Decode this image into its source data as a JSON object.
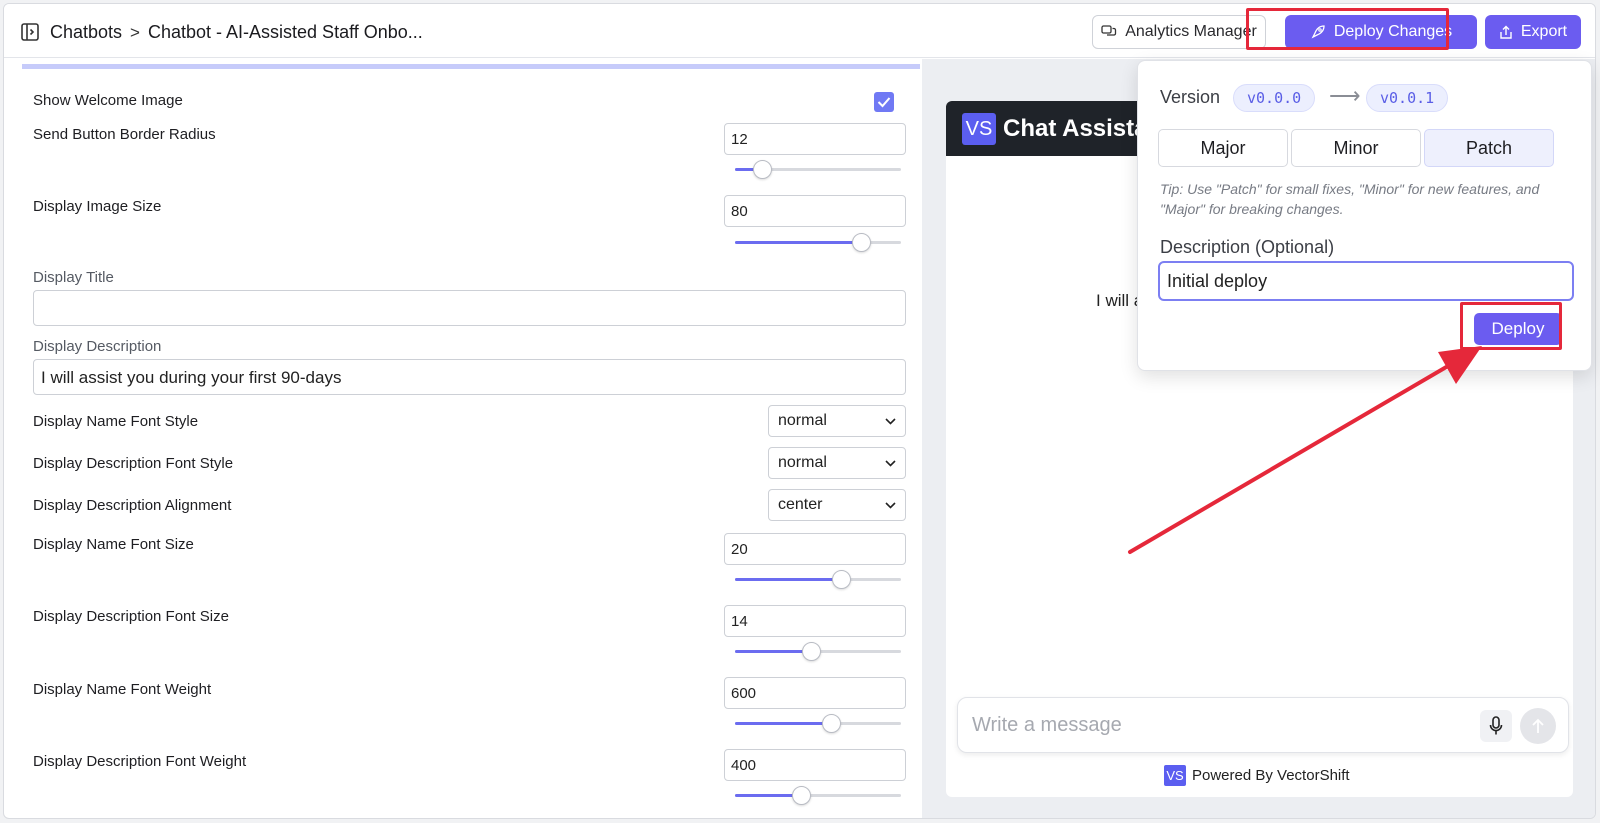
{
  "header": {
    "breadcrumb_root": "Chatbots",
    "breadcrumb_separator": ">",
    "breadcrumb_current": "Chatbot - AI-Assisted Staff Onbo...",
    "analytics_label": "Analytics Manager",
    "deploy_changes_label": "Deploy Changes",
    "export_label": "Export"
  },
  "settings": {
    "show_welcome_image_label": "Show Welcome Image",
    "show_welcome_image_checked": true,
    "send_button_border_radius": {
      "label": "Send Button Border Radius",
      "value": "12",
      "level": 0.16
    },
    "display_image_size": {
      "label": "Display Image Size",
      "value": "80",
      "level": 0.76
    },
    "display_title": {
      "label": "Display Title",
      "value": ""
    },
    "display_description": {
      "label": "Display Description",
      "value": "I will assist you during your first 90-days"
    },
    "display_name_font_style": {
      "label": "Display Name Font Style",
      "value": "normal"
    },
    "display_description_font_style": {
      "label": "Display Description Font Style",
      "value": "normal"
    },
    "display_description_alignment": {
      "label": "Display Description Alignment",
      "value": "center"
    },
    "display_name_font_size": {
      "label": "Display Name Font Size",
      "value": "20",
      "level": 0.64
    },
    "display_description_font_size": {
      "label": "Display Description Font Size",
      "value": "14",
      "level": 0.46
    },
    "display_name_font_weight": {
      "label": "Display Name Font Weight",
      "value": "600",
      "level": 0.58
    },
    "display_description_font_weight": {
      "label": "Display Description Font Weight",
      "value": "400",
      "level": 0.4
    }
  },
  "preview": {
    "logo_text": "VS",
    "chat_title": "Chat Assistan",
    "body_text": "I will as",
    "message_placeholder": "Write a message",
    "powered_logo": "VS",
    "powered_by": "Powered By VectorShift"
  },
  "deploy_popover": {
    "version_label": "Version",
    "from_version": "v0.0.0",
    "to_version": "v0.0.1",
    "options": [
      "Major",
      "Minor",
      "Patch"
    ],
    "selected_option": "Patch",
    "tip": "Tip: Use \"Patch\" for small fixes, \"Minor\" for new features, and \"Major\" for breaking changes.",
    "description_label": "Description (Optional)",
    "description_value": "Initial deploy",
    "deploy_label": "Deploy"
  },
  "colors": {
    "accent": "#6b5cf0",
    "highlight": "#e5283a",
    "chat_header": "#1f2329"
  }
}
